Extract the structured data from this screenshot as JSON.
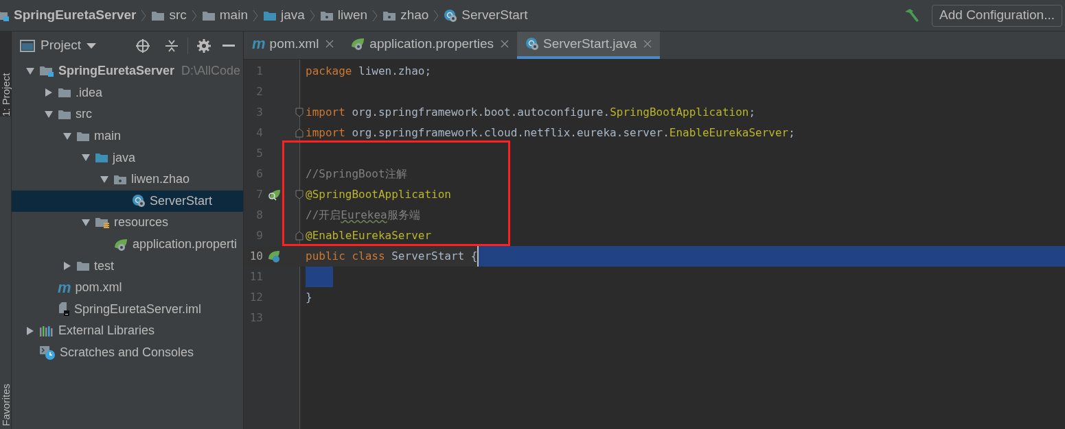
{
  "breadcrumbs": [
    {
      "label": "SpringEuretaServer",
      "kind": "module"
    },
    {
      "label": "src",
      "kind": "folder"
    },
    {
      "label": "main",
      "kind": "folder"
    },
    {
      "label": "java",
      "kind": "source"
    },
    {
      "label": "liwen",
      "kind": "package"
    },
    {
      "label": "zhao",
      "kind": "package"
    },
    {
      "label": "ServerStart",
      "kind": "class"
    }
  ],
  "toolbar": {
    "run_config": "Add Configuration..."
  },
  "side_strip": {
    "top": "1: Project",
    "bottom": "Favorites"
  },
  "project_panel": {
    "title": "Project",
    "tree": [
      {
        "label": "SpringEuretaServer",
        "path": "D:\\AllCode",
        "kind": "module",
        "expanded": true,
        "selected": false,
        "children": [
          {
            "label": ".idea",
            "kind": "folder",
            "expanded": false,
            "selected": false
          },
          {
            "label": "src",
            "kind": "folder",
            "expanded": true,
            "selected": false,
            "children": [
              {
                "label": "main",
                "kind": "folder",
                "expanded": true,
                "selected": false,
                "children": [
                  {
                    "label": "java",
                    "kind": "source",
                    "expanded": true,
                    "selected": false,
                    "children": [
                      {
                        "label": "liwen.zhao",
                        "kind": "package",
                        "expanded": true,
                        "selected": false,
                        "children": [
                          {
                            "label": "ServerStart",
                            "kind": "class",
                            "selected": true
                          }
                        ]
                      }
                    ]
                  },
                  {
                    "label": "resources",
                    "kind": "resources",
                    "expanded": true,
                    "selected": false,
                    "children": [
                      {
                        "label": "application.properti",
                        "kind": "properties",
                        "selected": false
                      }
                    ]
                  }
                ]
              },
              {
                "label": "test",
                "kind": "folder",
                "expanded": false,
                "selected": false
              }
            ]
          },
          {
            "label": "pom.xml",
            "kind": "maven",
            "icon_letter": "m",
            "selected": false
          },
          {
            "label": "SpringEuretaServer.iml",
            "kind": "iml",
            "selected": false
          }
        ]
      },
      {
        "label": "External Libraries",
        "kind": "libraries",
        "expanded": false,
        "selected": false
      },
      {
        "label": "Scratches and Consoles",
        "kind": "scratches",
        "selected": false
      }
    ]
  },
  "tabs": [
    {
      "label": "pom.xml",
      "kind": "maven",
      "icon_letter": "m",
      "selected": false
    },
    {
      "label": "application.properties",
      "kind": "properties",
      "selected": false
    },
    {
      "label": "ServerStart.java",
      "kind": "class",
      "selected": true
    }
  ],
  "editor": {
    "lines": [
      {
        "number": "1",
        "tokens": [
          {
            "kind": "keyword",
            "text": "package "
          },
          {
            "kind": "plain",
            "text": "liwen.zhao;"
          }
        ]
      },
      {
        "number": "2"
      },
      {
        "number": "3",
        "fold_start": true,
        "tokens": [
          {
            "kind": "keyword",
            "text": "import "
          },
          {
            "kind": "plain",
            "text": "org.springframework.boot.autoconfigure."
          },
          {
            "kind": "annotation",
            "text": "SpringBootApplication"
          },
          {
            "kind": "plain",
            "text": ";"
          }
        ]
      },
      {
        "number": "4",
        "fold_end": true,
        "tokens": [
          {
            "kind": "keyword",
            "text": "import "
          },
          {
            "kind": "plain",
            "text": "org.springframework.cloud.netflix.eureka.server."
          },
          {
            "kind": "annotation",
            "text": "EnableEurekaServer"
          },
          {
            "kind": "plain",
            "text": ";"
          }
        ]
      },
      {
        "number": "5"
      },
      {
        "number": "6",
        "tokens": [
          {
            "kind": "comment",
            "text": "//SpringBoot注解"
          }
        ]
      },
      {
        "number": "7",
        "fold_start": true,
        "find_marker": true,
        "tokens": [
          {
            "kind": "annotation",
            "text": "@SpringBootApplication"
          }
        ]
      },
      {
        "number": "8",
        "tokens": [
          {
            "kind": "comment",
            "text": "//开启"
          },
          {
            "kind": "typo",
            "text": "Eurekea"
          },
          {
            "kind": "comment",
            "text": "服务端"
          }
        ]
      },
      {
        "number": "9",
        "fold_end": true,
        "tokens": [
          {
            "kind": "annotation",
            "text": "@EnableEurekaServer"
          }
        ]
      },
      {
        "number": "10",
        "current": true,
        "selected": true,
        "bean_marker": true,
        "tokens": [
          {
            "kind": "keyword",
            "text": "public class "
          },
          {
            "kind": "plain",
            "text": "ServerStart {"
          }
        ]
      },
      {
        "number": "11",
        "selected": true
      },
      {
        "number": "12",
        "tokens": [
          {
            "kind": "plain",
            "text": "}"
          }
        ]
      },
      {
        "number": "13"
      }
    ]
  }
}
